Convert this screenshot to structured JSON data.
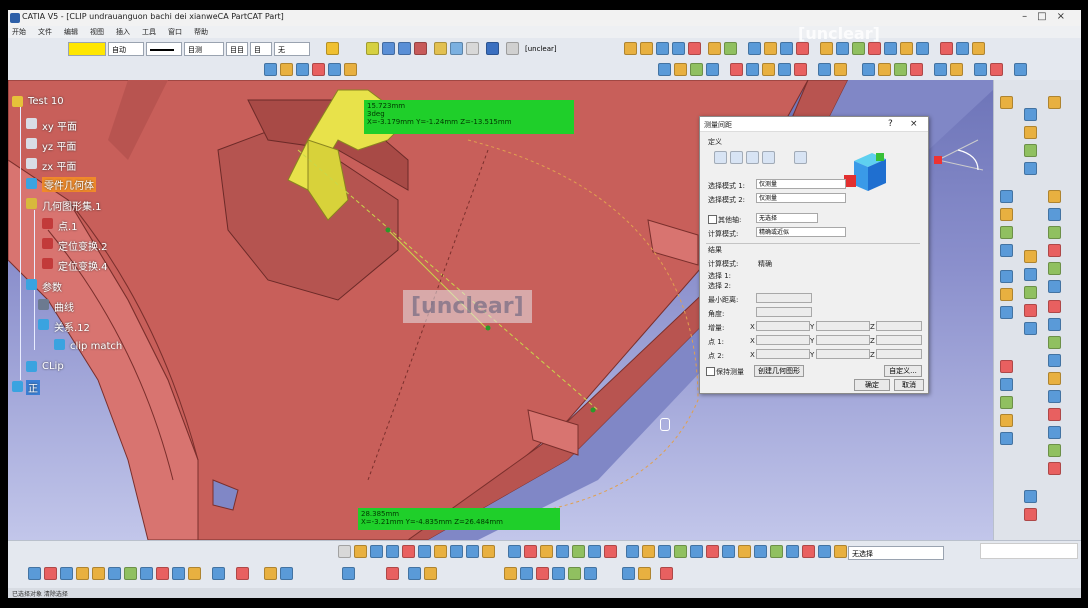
{
  "window": {
    "title": "CATIA V5 - [CLIP undrauanguon bachi dei xianweCA PartCAT Part]",
    "controls": [
      "–",
      "□",
      "×"
    ]
  },
  "menu": {
    "items": [
      "开始",
      "文件",
      "编辑",
      "视图",
      "插入",
      "工具",
      "窗口",
      "帮助"
    ]
  },
  "toolbar": {
    "color_value": "",
    "linetype_value": "自动",
    "layer_value": "目测",
    "extra1": "目目",
    "extra2": "目",
    "extra3": "无",
    "quick_select": "[unclear]"
  },
  "tree": {
    "nodes": [
      {
        "label": "Test 10",
        "icon": "gear-icon",
        "color": "#e6c23a"
      },
      {
        "label": "xy 平面",
        "icon": "plane-icon",
        "color": "#d9dde6"
      },
      {
        "label": "yz 平面",
        "icon": "plane-icon",
        "color": "#d9dde6"
      },
      {
        "label": "zx 平面",
        "icon": "plane-icon",
        "color": "#d9dde6"
      },
      {
        "label": "零件几何体",
        "icon": "body-icon",
        "color": "#3aa3e0",
        "highlight": true
      },
      {
        "label": "几何图形集.1",
        "icon": "geoset-icon",
        "color": "#d8b83c"
      },
      {
        "label": "点.1",
        "icon": "point-icon",
        "color": "#c23a3a"
      },
      {
        "label": "定位变换.2",
        "icon": "transform-icon",
        "color": "#c23a3a"
      },
      {
        "label": "定位变换.4",
        "icon": "transform-icon",
        "color": "#c23a3a"
      },
      {
        "label": "参数",
        "icon": "params-icon",
        "color": "#3aa3e0"
      },
      {
        "label": "曲线",
        "icon": "curve-icon",
        "color": "#6c7a90"
      },
      {
        "label": "关系.12",
        "icon": "relations-icon",
        "color": "#3aa3e0"
      },
      {
        "label": "clip match",
        "icon": "clip-icon",
        "color": "#3aa3e0"
      },
      {
        "label": "CLip",
        "icon": "clip-icon",
        "color": "#3aa3e0"
      },
      {
        "label": "正",
        "icon": "axis-icon",
        "color": "#3aa3e0"
      }
    ]
  },
  "viewport": {
    "measure_top": {
      "line1": "15.723mm",
      "line2": "3deg",
      "line3": "X=-3.179mm  Y=-1.24mm  Z=-13.515mm"
    },
    "measure_bottom": {
      "line1": "28.385mm",
      "line2": "X=-3.21mm  Y=-4.835mm  Z=26.484mm"
    },
    "watermark_center": "[unclear]",
    "watermark_top": "[unclear]"
  },
  "dialog": {
    "title": "测量间距",
    "help": "?",
    "close": "×",
    "section_definition": "定义",
    "mode1_label": "选择模式 1:",
    "mode1_value": "仅测量",
    "mode2_label": "选择模式 2:",
    "mode2_value": "仅测量",
    "other_axis_label": "其他轴:",
    "other_axis_value": "无选择",
    "calc_mode_label": "计算模式:",
    "calc_mode_value": "精确或近似",
    "section_result": "结果",
    "result_mode_label": "计算模式:",
    "result_mode_value": "精确",
    "sel1_label": "选择 1:",
    "sel2_label": "选择 2:",
    "min_dist_label": "最小距离:",
    "angle_label": "角度:",
    "delta_label": "增量:",
    "point1_label": "点 1:",
    "point2_label": "点 2:",
    "x": "X",
    "y": "Y",
    "z": "Z",
    "keep_label": "保持测量",
    "create_geom_button": "创建几何图形",
    "customize_button": "自定义...",
    "ok_button": "确定",
    "cancel_button": "取消"
  },
  "bottom": {
    "extra_select": "无选择",
    "status_text": "已选择对象 清除选择"
  },
  "colors": {
    "part_fill": "#c85f5a",
    "measure_green": "#1fcf2a",
    "viewport_bg": "#8a8fcc",
    "yellow_part": "#e8e24a"
  }
}
